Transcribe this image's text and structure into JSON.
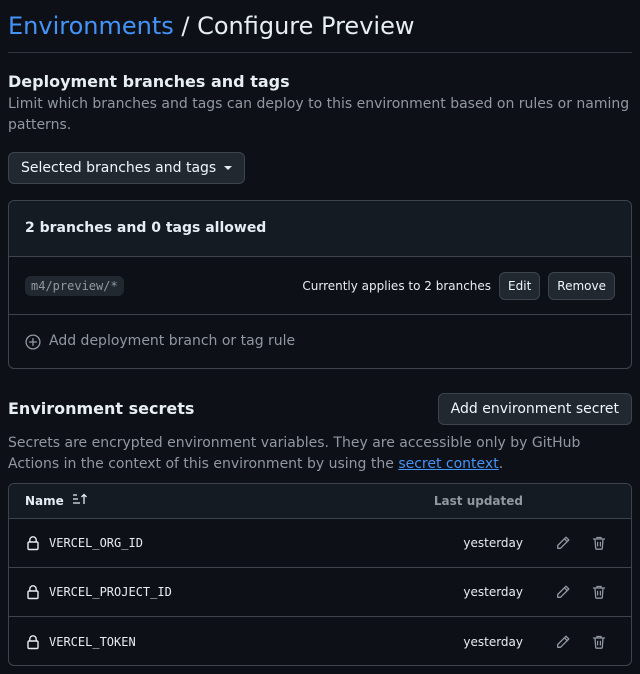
{
  "breadcrumb": {
    "parent": "Environments",
    "separator": " / ",
    "current": "Configure Preview"
  },
  "deployment": {
    "title": "Deployment branches and tags",
    "description": "Limit which branches and tags can deploy to this environment based on rules or naming patterns.",
    "select_label": "Selected branches and tags",
    "summary": "2 branches and 0 tags allowed",
    "rules": [
      {
        "pattern": "m4/preview/*",
        "applies": "Currently applies to 2 branches",
        "edit_label": "Edit",
        "remove_label": "Remove"
      }
    ],
    "add_rule_label": "Add deployment branch or tag rule"
  },
  "secrets": {
    "title": "Environment secrets",
    "add_button": "Add environment secret",
    "description_before": "Secrets are encrypted environment variables. They are accessible only by GitHub Actions in the context of this environment by using the ",
    "description_link": "secret context",
    "description_after": ".",
    "columns": {
      "name": "Name",
      "updated": "Last updated"
    },
    "rows": [
      {
        "name": "VERCEL_ORG_ID",
        "updated": "yesterday"
      },
      {
        "name": "VERCEL_PROJECT_ID",
        "updated": "yesterday"
      },
      {
        "name": "VERCEL_TOKEN",
        "updated": "yesterday"
      }
    ]
  },
  "colors": {
    "background": "#0d1117",
    "link": "#4493f8",
    "border": "#3d444d",
    "muted": "#9198a1"
  },
  "icons": {
    "select_caret": "triangle-down-icon",
    "add_rule": "plus-circle-icon",
    "sort": "sort-asc-icon",
    "secret": "lock-icon",
    "edit": "pencil-icon",
    "delete": "trash-icon"
  }
}
